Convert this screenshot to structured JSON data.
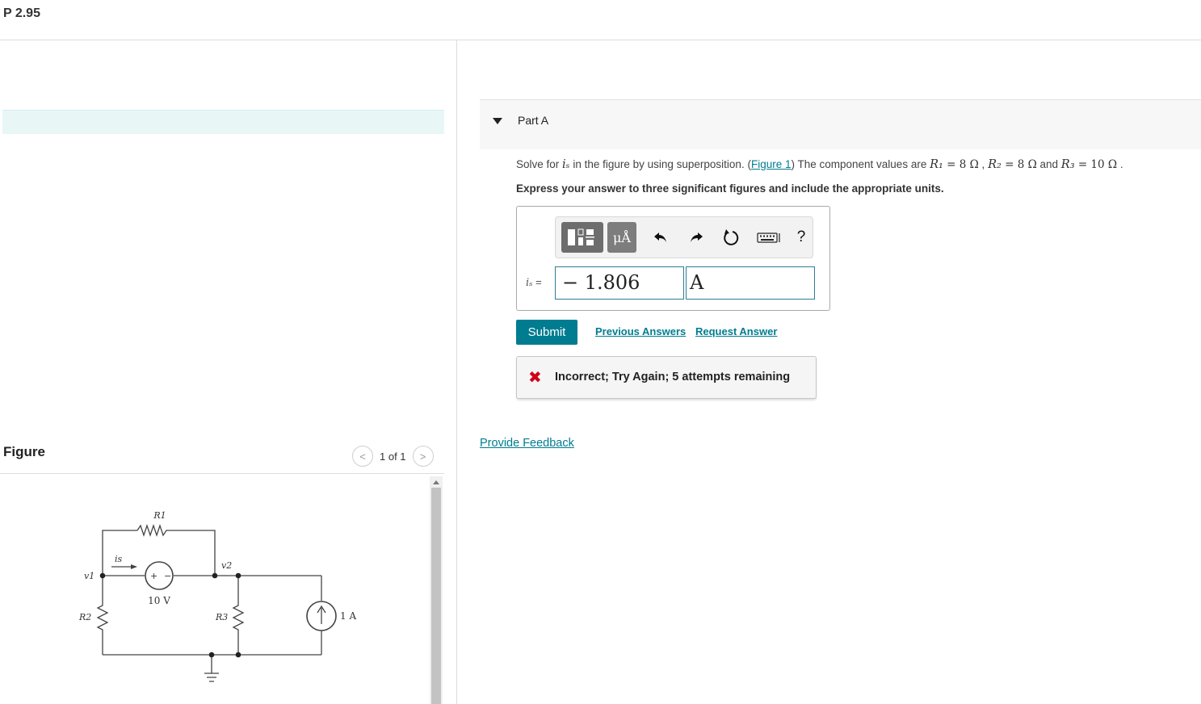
{
  "page": {
    "title": "P 2.95"
  },
  "figure_panel": {
    "heading": "Figure",
    "counter": "1 of 1",
    "prev_glyph": "<",
    "next_glyph": ">"
  },
  "circuit": {
    "labels": {
      "r1": "R1",
      "r2": "R2",
      "r3": "R3",
      "v1": "v1",
      "v2": "v2",
      "is": "is",
      "voltage_source": "10 V",
      "current_source": "1 A",
      "plus": "+",
      "minus": "−"
    }
  },
  "part_a": {
    "title": "Part A",
    "question": {
      "before": "Solve for ",
      "var": "iₛ",
      "mid": " in the figure by using superposition. (",
      "figure_link": "Figure 1",
      "after": ") The component values are ",
      "r1_name": "R₁",
      "r1_val": " = 8 Ω",
      "sep1": " , ",
      "r2_name": "R₂",
      "r2_val": " = 8 Ω",
      "and": " and ",
      "r3_name": "R₃",
      "r3_val": " = 10 Ω",
      "end": " ."
    },
    "instruction": "Express your answer to three significant figures and include the appropriate units.",
    "toolbar": {
      "units_label": "μÅ",
      "help_label": "?"
    },
    "answer": {
      "label_var": "iₛ",
      "label_eq": " =",
      "value": "− 1.806",
      "unit": "A"
    },
    "actions": {
      "submit": "Submit",
      "previous_answers": "Previous Answers",
      "request_answer": "Request Answer"
    },
    "feedback": {
      "message": "Incorrect; Try Again; 5 attempts remaining",
      "status_color": "#d0021b"
    },
    "provide_feedback": "Provide Feedback"
  },
  "colors": {
    "accent": "#007c91",
    "banner": "#e8f6f6"
  }
}
